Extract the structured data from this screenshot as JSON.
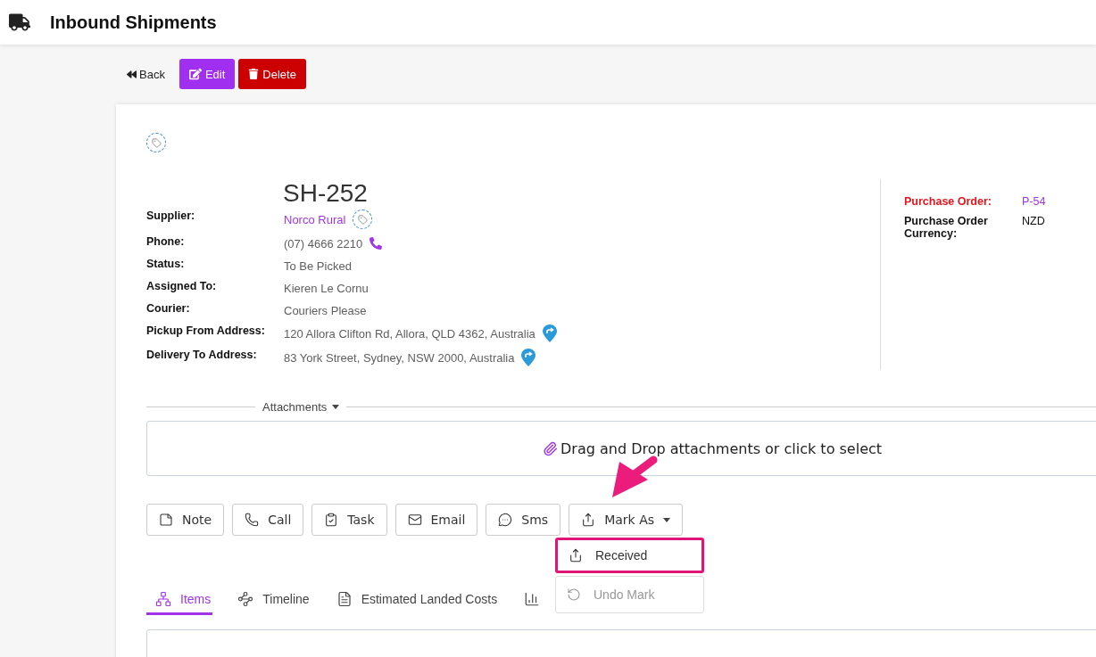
{
  "header": {
    "title": "Inbound Shipments"
  },
  "toolbar": {
    "back": "Back",
    "edit": "Edit",
    "delete": "Delete"
  },
  "shipment": {
    "number": "SH-252",
    "fields": [
      {
        "label": "Supplier:",
        "value": "Norco Rural",
        "kind": "link_tag"
      },
      {
        "label": "Phone:",
        "value": "(07) 4666 2210",
        "kind": "phone"
      },
      {
        "label": "Status:",
        "value": "To Be Picked",
        "kind": "text"
      },
      {
        "label": "Assigned To:",
        "value": "Kieren Le Cornu",
        "kind": "text"
      },
      {
        "label": "Courier:",
        "value": "Couriers Please",
        "kind": "text"
      },
      {
        "label": "Pickup From Address:",
        "value": "120 Allora Clifton Rd, Allora, QLD 4362, Australia",
        "kind": "address"
      },
      {
        "label": "Delivery To Address:",
        "value": "83 York Street, Sydney, NSW 2000, Australia",
        "kind": "address"
      }
    ],
    "side_fields": [
      {
        "label": "Purchase Order:",
        "value": "P-54",
        "kind": "highlight"
      },
      {
        "label": "Purchase Order Currency:",
        "value": "NZD",
        "kind": "text"
      }
    ]
  },
  "attachments": {
    "label": "Attachments",
    "dropzone": "Drag and Drop attachments or click to select"
  },
  "actions": [
    {
      "label": "Note",
      "kind": "note"
    },
    {
      "label": "Call",
      "kind": "call"
    },
    {
      "label": "Task",
      "kind": "task"
    },
    {
      "label": "Email",
      "kind": "email"
    },
    {
      "label": "Sms",
      "kind": "sms"
    },
    {
      "label": "Mark As",
      "kind": "mark"
    }
  ],
  "mark_menu": {
    "expanded": true,
    "items": [
      {
        "label": "Received",
        "kind": "mark",
        "disabled": false,
        "selected": true
      },
      {
        "label": "Undo Mark",
        "kind": "undo",
        "disabled": true,
        "selected": false
      }
    ]
  },
  "tabs": [
    {
      "label": "Items",
      "kind": "items",
      "selected": true
    },
    {
      "label": "Timeline",
      "kind": "timeline",
      "selected": false
    },
    {
      "label": "Estimated Landed Costs",
      "kind": "costs",
      "selected": false
    },
    {
      "kind": "chart",
      "selected": false
    }
  ]
}
